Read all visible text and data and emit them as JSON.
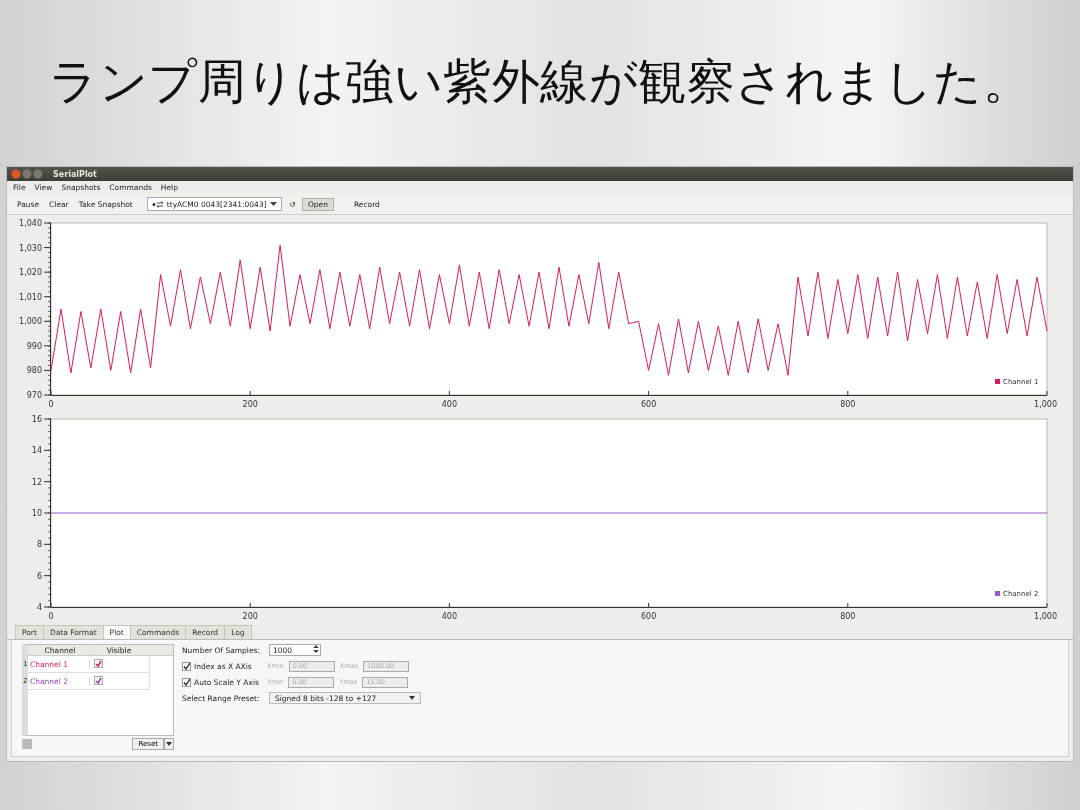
{
  "slide_title": "ランプ周りは強い紫外線が観察されました。",
  "window": {
    "title": "SerialPlot"
  },
  "menu": [
    "File",
    "View",
    "Snapshots",
    "Commands",
    "Help"
  ],
  "toolbar": {
    "buttons": [
      "Pause",
      "Clear",
      "Take Snapshot"
    ],
    "port": "ttyACM0 0043[2341:0043]",
    "refresh": "↺",
    "open": "Open",
    "record": "Record"
  },
  "plots": [
    {
      "chart_data": {
        "type": "line",
        "xlim": [
          0,
          1000
        ],
        "ylim": [
          970,
          1040
        ],
        "xticks": [
          0,
          200,
          400,
          600,
          800,
          {
            "value": 1000,
            "label": "1,000"
          }
        ],
        "yticks": [
          970,
          980,
          990,
          {
            "value": 1000,
            "label": "1,000"
          },
          {
            "value": 1010,
            "label": "1,010"
          },
          {
            "value": 1020,
            "label": "1,020"
          },
          {
            "value": 1030,
            "label": "1,030"
          },
          {
            "value": 1040,
            "label": "1,040"
          }
        ],
        "x": [
          0,
          10,
          20,
          30,
          40,
          50,
          60,
          70,
          80,
          90,
          100,
          110,
          120,
          130,
          140,
          150,
          160,
          170,
          180,
          190,
          200,
          210,
          220,
          230,
          240,
          250,
          260,
          270,
          280,
          290,
          300,
          310,
          320,
          330,
          340,
          350,
          360,
          370,
          380,
          390,
          400,
          410,
          420,
          430,
          440,
          450,
          460,
          470,
          480,
          490,
          500,
          510,
          520,
          530,
          540,
          550,
          560,
          570,
          580,
          590,
          600,
          610,
          620,
          630,
          640,
          650,
          660,
          670,
          680,
          690,
          700,
          710,
          720,
          730,
          740,
          750,
          760,
          770,
          780,
          790,
          800,
          810,
          820,
          830,
          840,
          850,
          860,
          870,
          880,
          890,
          900,
          910,
          920,
          930,
          940,
          950,
          960,
          970,
          980,
          990,
          1000
        ],
        "series": [
          {
            "name": "Channel 1",
            "color": "#d81b60",
            "values": [
              980,
              1005,
              979,
              1004,
              981,
              1005,
              980,
              1004,
              979,
              1005,
              981,
              1019,
              998,
              1021,
              997,
              1018,
              999,
              1020,
              998,
              1025,
              997,
              1022,
              996,
              1031,
              998,
              1019,
              999,
              1021,
              997,
              1020,
              998,
              1019,
              997,
              1022,
              999,
              1020,
              998,
              1021,
              997,
              1019,
              999,
              1023,
              998,
              1020,
              997,
              1021,
              999,
              1019,
              998,
              1020,
              997,
              1022,
              998,
              1019,
              999,
              1024,
              997,
              1020,
              999,
              1000,
              980,
              999,
              978,
              1001,
              979,
              1000,
              980,
              998,
              978,
              1000,
              979,
              1001,
              980,
              999,
              978,
              1018,
              994,
              1020,
              993,
              1017,
              995,
              1019,
              993,
              1018,
              994,
              1020,
              992,
              1017,
              995,
              1019,
              993,
              1018,
              994,
              1016,
              993,
              1019,
              995,
              1017,
              994,
              1018,
              996
            ]
          }
        ]
      }
    },
    {
      "chart_data": {
        "type": "line",
        "xlim": [
          0,
          1000
        ],
        "ylim": [
          4,
          16
        ],
        "xticks": [
          0,
          200,
          400,
          600,
          800,
          {
            "value": 1000,
            "label": "1,000"
          }
        ],
        "yticks": [
          4,
          6,
          8,
          10,
          12,
          14,
          16
        ],
        "x": [
          0,
          1000
        ],
        "series": [
          {
            "name": "Channel 2",
            "color": "#9b59d0",
            "values": [
              10,
              10
            ]
          }
        ]
      }
    }
  ],
  "tabs": [
    {
      "label": "Port",
      "selected": false
    },
    {
      "label": "Data Format",
      "selected": false
    },
    {
      "label": "Plot",
      "selected": true
    },
    {
      "label": "Commands",
      "selected": false
    },
    {
      "label": "Record",
      "selected": false
    },
    {
      "label": "Log",
      "selected": false
    }
  ],
  "plot_tab": {
    "channel_table": {
      "columns": [
        "Channel",
        "Visible"
      ],
      "rows": [
        {
          "index": "1",
          "name": "Channel 1",
          "color": "#d81b60",
          "visible": true
        },
        {
          "index": "2",
          "name": "Channel 2",
          "color": "#8e44ad",
          "visible": true
        }
      ]
    },
    "reset": "Reset",
    "samples": {
      "label": "Number Of Samples:",
      "value": "1000"
    },
    "axes": [
      {
        "label": "Index as X AXis",
        "checked": true,
        "min_label": "Xmin",
        "min": "0.00",
        "max_label": "Xmax",
        "max": "1000.00"
      },
      {
        "label": "Auto Scale Y Axis",
        "checked": true,
        "min_label": "Ymin",
        "min": "0.00",
        "max_label": "Ymax",
        "max": "15.00"
      }
    ],
    "range_preset": {
      "label": "Select Range Preset:",
      "value": "Signed 8 bits -128 to +127"
    }
  }
}
